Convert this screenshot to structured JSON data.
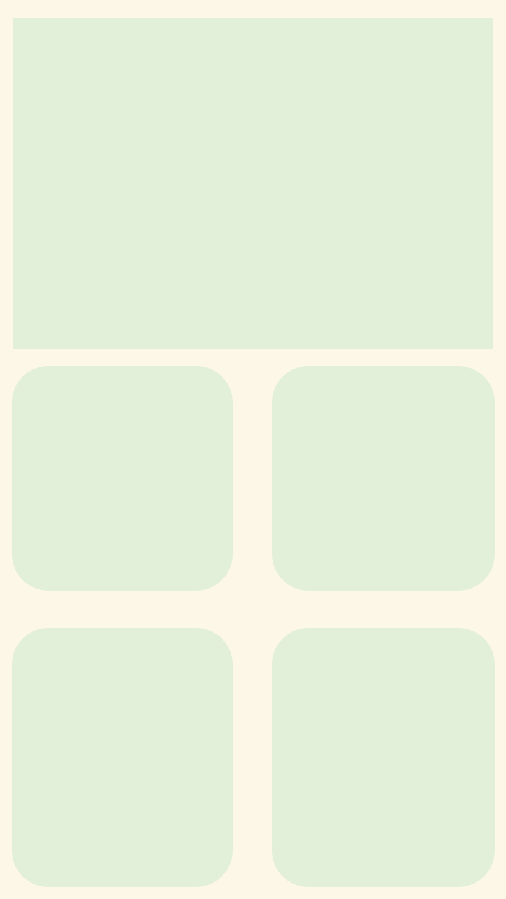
{
  "theme": {
    "background_color": "#FDF7E7",
    "panel_color": "#E2EFD9"
  },
  "layout": {
    "hero": {
      "label": ""
    },
    "tiles": [
      {
        "label": ""
      },
      {
        "label": ""
      },
      {
        "label": ""
      },
      {
        "label": ""
      }
    ]
  }
}
